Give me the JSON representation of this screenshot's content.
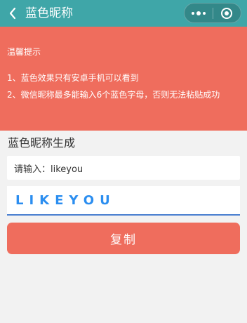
{
  "colors": {
    "navbar": "#3fa6a8",
    "accent": "#ef6d5d",
    "blue_text": "#2b8ef0",
    "background": "#f2f2f2"
  },
  "navbar": {
    "title": "蓝色昵称",
    "back_icon": "chevron-left-icon",
    "menu_icon": "more-dots-icon",
    "close_icon": "target-icon"
  },
  "tips": {
    "title": "温馨提示",
    "lines": [
      "1、蓝色效果只有安卓手机可以看到",
      "2、微信昵称最多能输入6个蓝色字母，否则无法粘贴成功"
    ]
  },
  "generator": {
    "title": "蓝色昵称生成",
    "input_text": "请输入：likeyou",
    "output_text": "LIKEYOU",
    "copy_label": "复制"
  }
}
